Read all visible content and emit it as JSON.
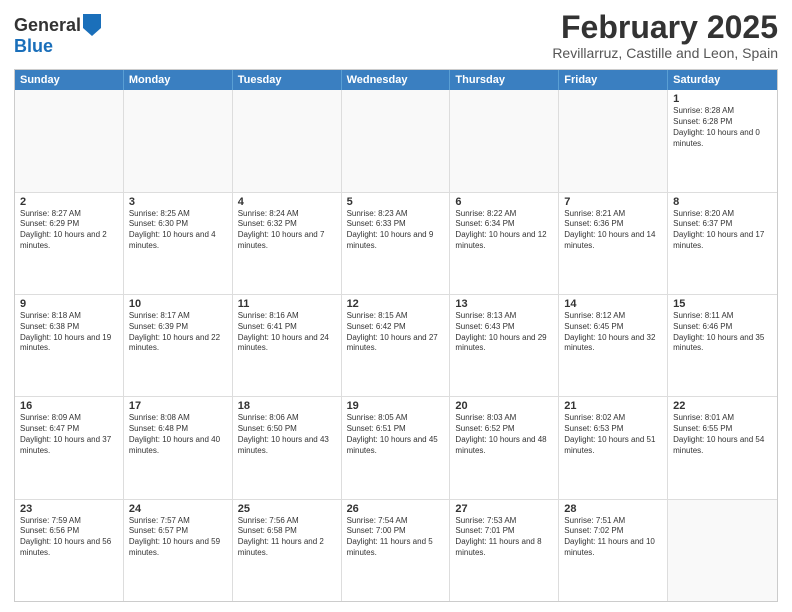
{
  "logo": {
    "line1": "General",
    "line2": "Blue"
  },
  "title": "February 2025",
  "subtitle": "Revillarruz, Castille and Leon, Spain",
  "header_days": [
    "Sunday",
    "Monday",
    "Tuesday",
    "Wednesday",
    "Thursday",
    "Friday",
    "Saturday"
  ],
  "weeks": [
    [
      {
        "day": "",
        "info": ""
      },
      {
        "day": "",
        "info": ""
      },
      {
        "day": "",
        "info": ""
      },
      {
        "day": "",
        "info": ""
      },
      {
        "day": "",
        "info": ""
      },
      {
        "day": "",
        "info": ""
      },
      {
        "day": "1",
        "info": "Sunrise: 8:28 AM\nSunset: 6:28 PM\nDaylight: 10 hours and 0 minutes."
      }
    ],
    [
      {
        "day": "2",
        "info": "Sunrise: 8:27 AM\nSunset: 6:29 PM\nDaylight: 10 hours and 2 minutes."
      },
      {
        "day": "3",
        "info": "Sunrise: 8:25 AM\nSunset: 6:30 PM\nDaylight: 10 hours and 4 minutes."
      },
      {
        "day": "4",
        "info": "Sunrise: 8:24 AM\nSunset: 6:32 PM\nDaylight: 10 hours and 7 minutes."
      },
      {
        "day": "5",
        "info": "Sunrise: 8:23 AM\nSunset: 6:33 PM\nDaylight: 10 hours and 9 minutes."
      },
      {
        "day": "6",
        "info": "Sunrise: 8:22 AM\nSunset: 6:34 PM\nDaylight: 10 hours and 12 minutes."
      },
      {
        "day": "7",
        "info": "Sunrise: 8:21 AM\nSunset: 6:36 PM\nDaylight: 10 hours and 14 minutes."
      },
      {
        "day": "8",
        "info": "Sunrise: 8:20 AM\nSunset: 6:37 PM\nDaylight: 10 hours and 17 minutes."
      }
    ],
    [
      {
        "day": "9",
        "info": "Sunrise: 8:18 AM\nSunset: 6:38 PM\nDaylight: 10 hours and 19 minutes."
      },
      {
        "day": "10",
        "info": "Sunrise: 8:17 AM\nSunset: 6:39 PM\nDaylight: 10 hours and 22 minutes."
      },
      {
        "day": "11",
        "info": "Sunrise: 8:16 AM\nSunset: 6:41 PM\nDaylight: 10 hours and 24 minutes."
      },
      {
        "day": "12",
        "info": "Sunrise: 8:15 AM\nSunset: 6:42 PM\nDaylight: 10 hours and 27 minutes."
      },
      {
        "day": "13",
        "info": "Sunrise: 8:13 AM\nSunset: 6:43 PM\nDaylight: 10 hours and 29 minutes."
      },
      {
        "day": "14",
        "info": "Sunrise: 8:12 AM\nSunset: 6:45 PM\nDaylight: 10 hours and 32 minutes."
      },
      {
        "day": "15",
        "info": "Sunrise: 8:11 AM\nSunset: 6:46 PM\nDaylight: 10 hours and 35 minutes."
      }
    ],
    [
      {
        "day": "16",
        "info": "Sunrise: 8:09 AM\nSunset: 6:47 PM\nDaylight: 10 hours and 37 minutes."
      },
      {
        "day": "17",
        "info": "Sunrise: 8:08 AM\nSunset: 6:48 PM\nDaylight: 10 hours and 40 minutes."
      },
      {
        "day": "18",
        "info": "Sunrise: 8:06 AM\nSunset: 6:50 PM\nDaylight: 10 hours and 43 minutes."
      },
      {
        "day": "19",
        "info": "Sunrise: 8:05 AM\nSunset: 6:51 PM\nDaylight: 10 hours and 45 minutes."
      },
      {
        "day": "20",
        "info": "Sunrise: 8:03 AM\nSunset: 6:52 PM\nDaylight: 10 hours and 48 minutes."
      },
      {
        "day": "21",
        "info": "Sunrise: 8:02 AM\nSunset: 6:53 PM\nDaylight: 10 hours and 51 minutes."
      },
      {
        "day": "22",
        "info": "Sunrise: 8:01 AM\nSunset: 6:55 PM\nDaylight: 10 hours and 54 minutes."
      }
    ],
    [
      {
        "day": "23",
        "info": "Sunrise: 7:59 AM\nSunset: 6:56 PM\nDaylight: 10 hours and 56 minutes."
      },
      {
        "day": "24",
        "info": "Sunrise: 7:57 AM\nSunset: 6:57 PM\nDaylight: 10 hours and 59 minutes."
      },
      {
        "day": "25",
        "info": "Sunrise: 7:56 AM\nSunset: 6:58 PM\nDaylight: 11 hours and 2 minutes."
      },
      {
        "day": "26",
        "info": "Sunrise: 7:54 AM\nSunset: 7:00 PM\nDaylight: 11 hours and 5 minutes."
      },
      {
        "day": "27",
        "info": "Sunrise: 7:53 AM\nSunset: 7:01 PM\nDaylight: 11 hours and 8 minutes."
      },
      {
        "day": "28",
        "info": "Sunrise: 7:51 AM\nSunset: 7:02 PM\nDaylight: 11 hours and 10 minutes."
      },
      {
        "day": "",
        "info": ""
      }
    ]
  ]
}
